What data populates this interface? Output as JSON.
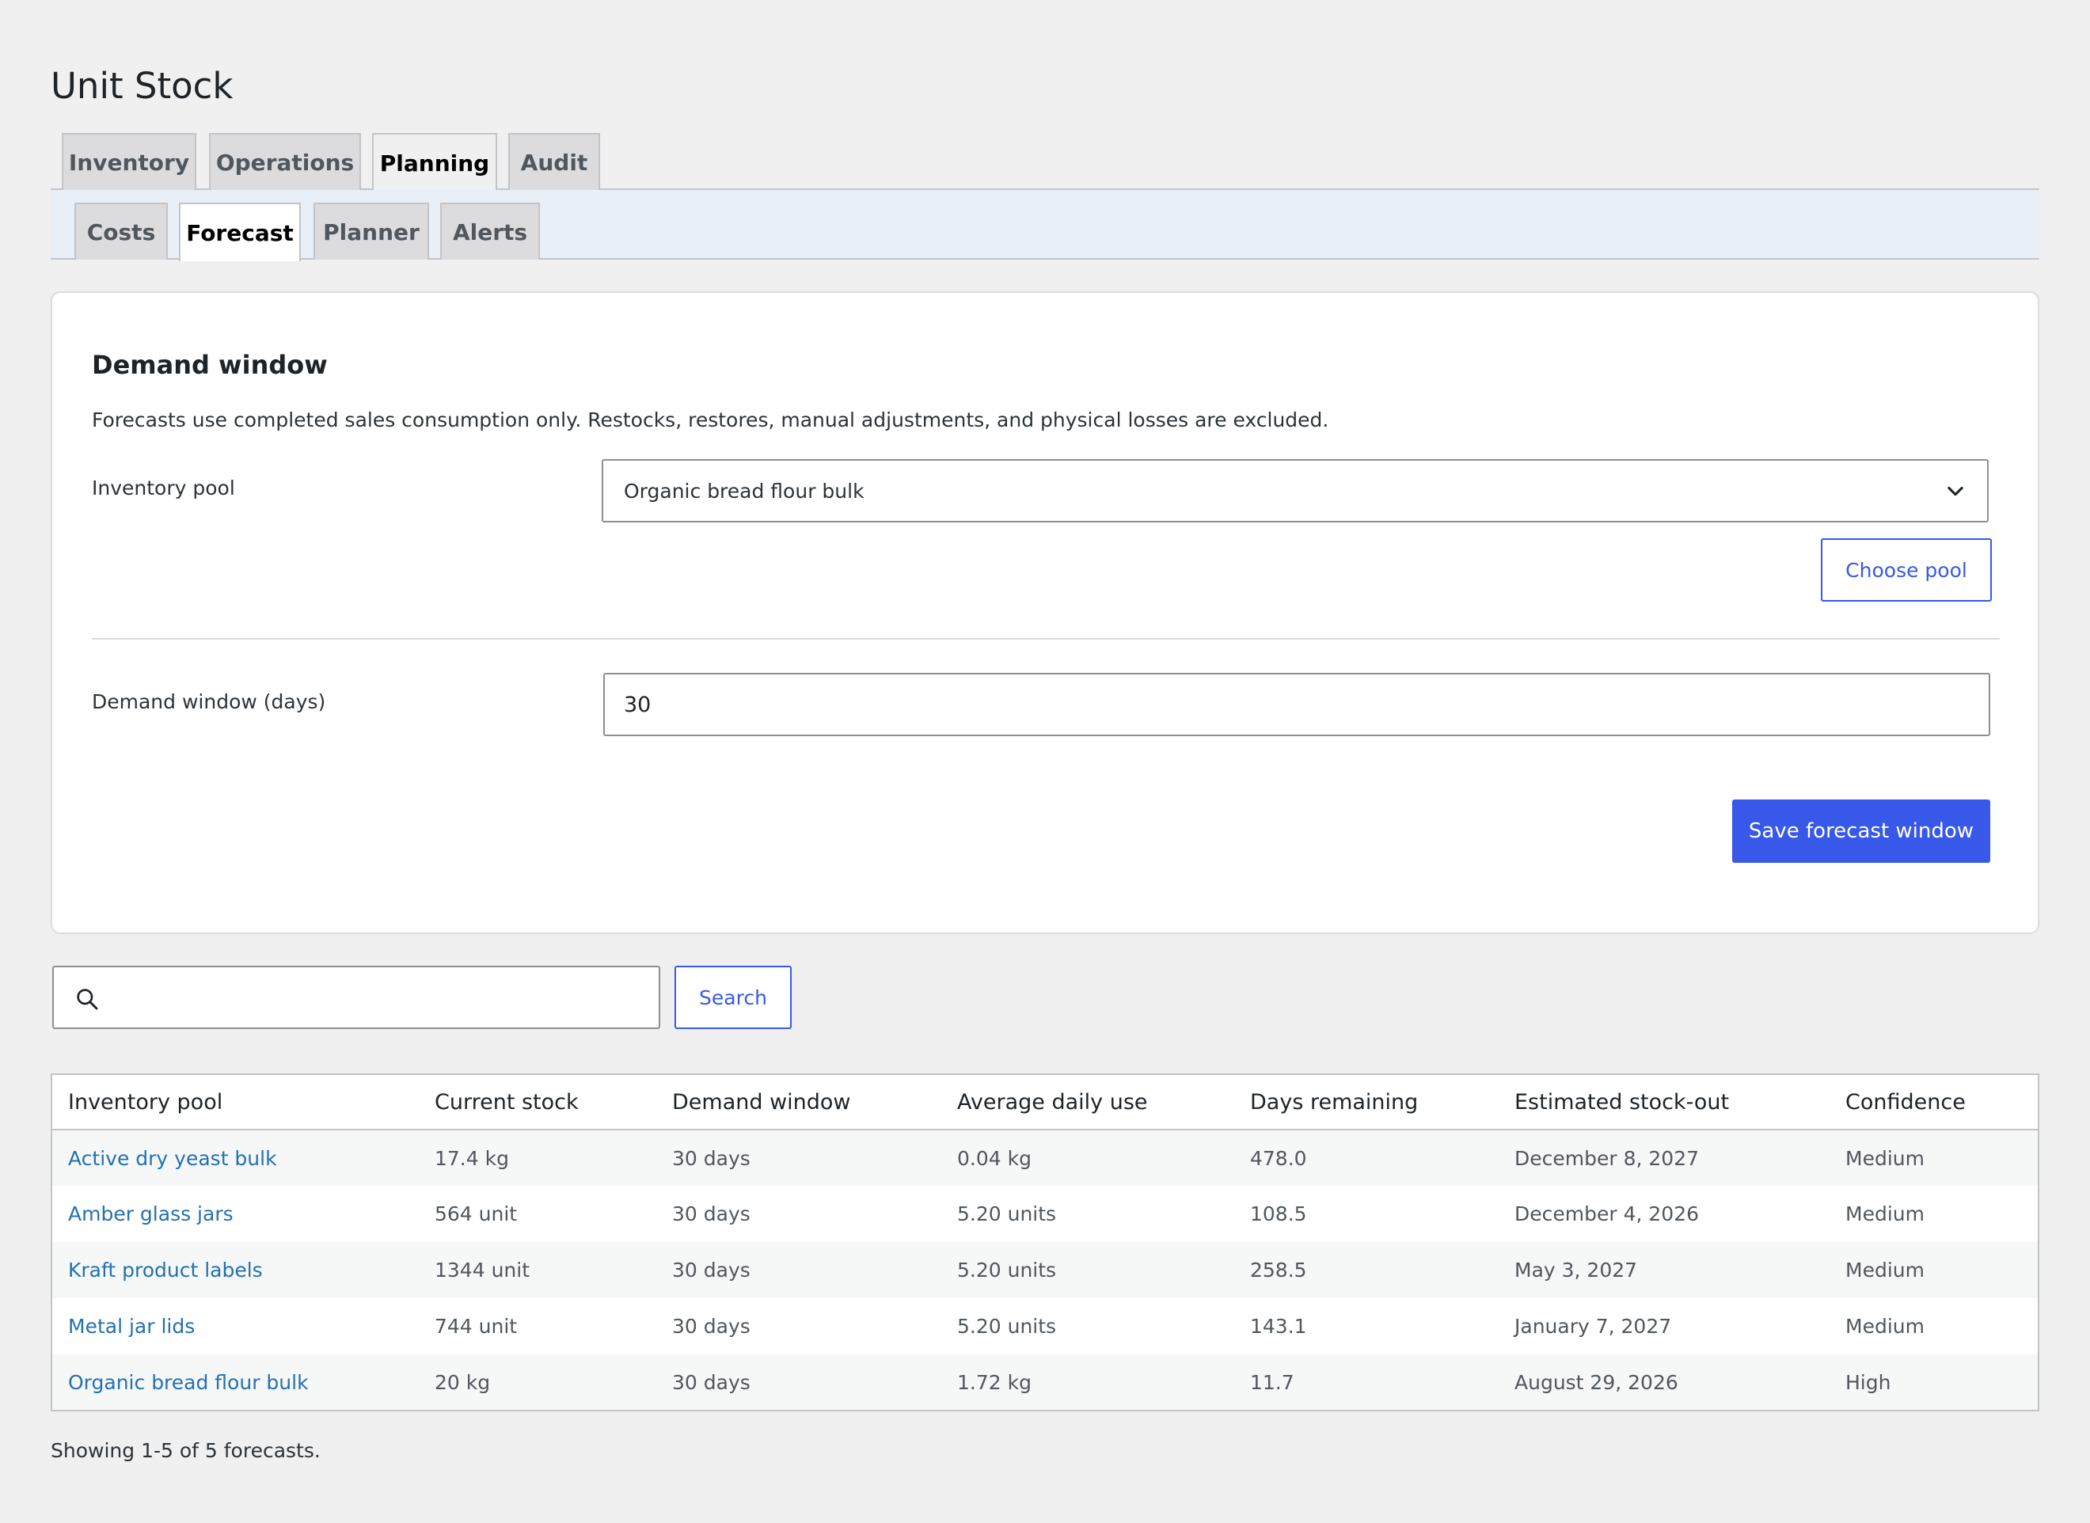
{
  "app": {
    "title": "Unit Stock"
  },
  "tabs": [
    {
      "label": "Inventory"
    },
    {
      "label": "Operations"
    },
    {
      "label": "Planning",
      "active": true
    },
    {
      "label": "Audit"
    }
  ],
  "subtabs": [
    {
      "label": "Costs"
    },
    {
      "label": "Forecast",
      "active": true
    },
    {
      "label": "Planner"
    },
    {
      "label": "Alerts"
    }
  ],
  "card": {
    "title": "Demand window",
    "description": "Forecasts use completed sales consumption only. Restocks, restores, manual adjustments, and physical losses are excluded.",
    "pool_label": "Inventory pool",
    "pool_selected": "Organic bread flour bulk",
    "choose_pool_label": "Choose pool",
    "window_label": "Demand window (days)",
    "window_value": "30",
    "save_label": "Save forecast window"
  },
  "search": {
    "placeholder": "",
    "button_label": "Search"
  },
  "table": {
    "columns": [
      "Inventory pool",
      "Current stock",
      "Demand window",
      "Average daily use",
      "Days remaining",
      "Estimated stock-out",
      "Confidence"
    ],
    "rows": [
      [
        "Active dry yeast bulk",
        "17.4 kg",
        "30 days",
        "0.04 kg",
        "478.0",
        "December 8, 2027",
        "Medium"
      ],
      [
        "Amber glass jars",
        "564 unit",
        "30 days",
        "5.20 units",
        "108.5",
        "December 4, 2026",
        "Medium"
      ],
      [
        "Kraft product labels",
        "1344 unit",
        "30 days",
        "5.20 units",
        "258.5",
        "May 3, 2027",
        "Medium"
      ],
      [
        "Metal jar lids",
        "744 unit",
        "30 days",
        "5.20 units",
        "143.1",
        "January 7, 2027",
        "Medium"
      ],
      [
        "Organic bread flour bulk",
        "20 kg",
        "30 days",
        "1.72 kg",
        "11.7",
        "August 29, 2026",
        "High"
      ]
    ]
  },
  "footer": {
    "summary": "Showing 1-5 of 5 forecasts."
  },
  "colors": {
    "accent": "#3858e9",
    "link": "#2271b1",
    "background": "#f0f0f1"
  }
}
